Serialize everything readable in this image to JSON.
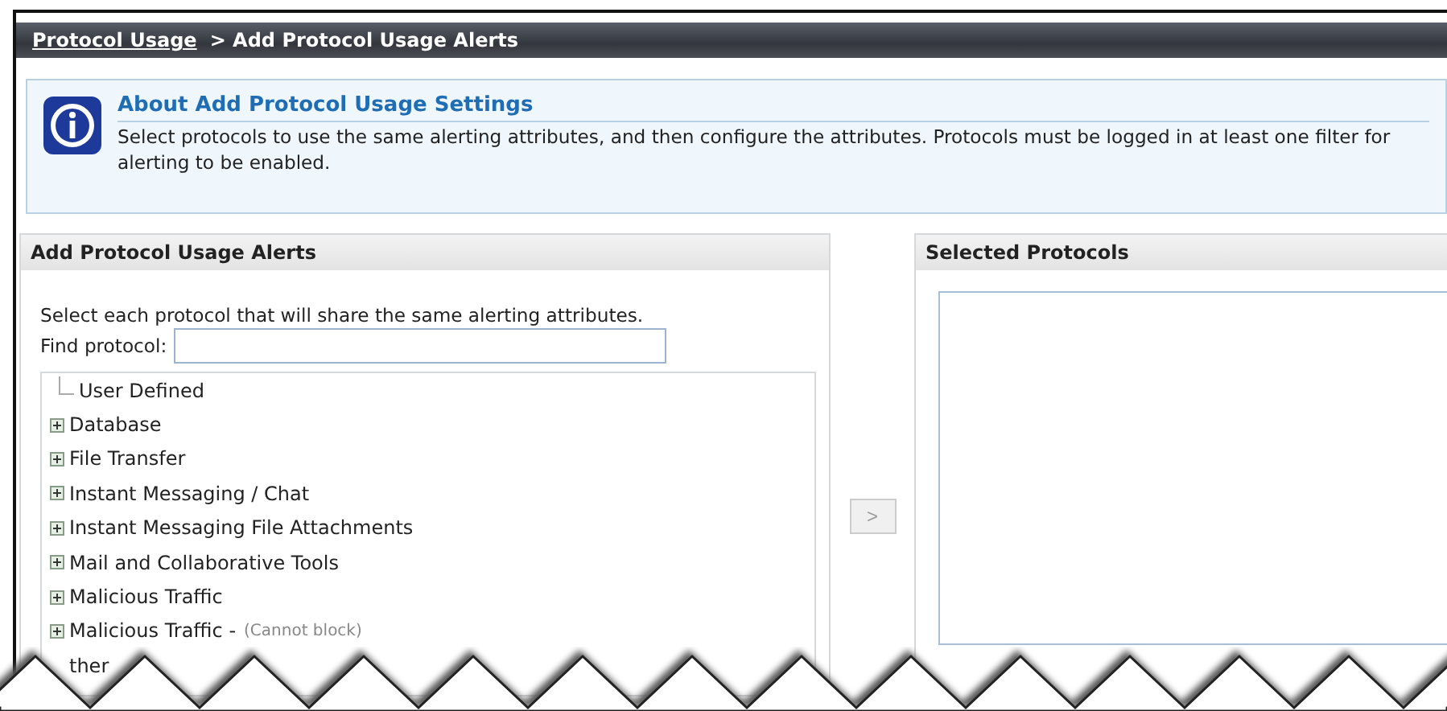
{
  "breadcrumb": {
    "link": "Protocol Usage",
    "current": "> Add Protocol Usage Alerts"
  },
  "info": {
    "title": "About Add Protocol Usage Settings",
    "text": "Select protocols to use the same alerting attributes, and then configure the attributes. Protocols must be logged in at least one filter for alerting to be enabled."
  },
  "left_panel": {
    "title": "Add Protocol Usage Alerts",
    "instructions": "Select each protocol that will share the same alerting attributes.",
    "find_label": "Find protocol:",
    "tree": [
      {
        "label": "User Defined",
        "kind": "leaf"
      },
      {
        "label": "Database",
        "kind": "group"
      },
      {
        "label": "File Transfer",
        "kind": "group"
      },
      {
        "label": "Instant Messaging / Chat",
        "kind": "group"
      },
      {
        "label": "Instant Messaging File Attachments",
        "kind": "group"
      },
      {
        "label": "Mail and Collaborative Tools",
        "kind": "group"
      },
      {
        "label": "Malicious Traffic",
        "kind": "group"
      },
      {
        "label": "Malicious Traffic -",
        "note": "(Cannot block)",
        "kind": "group"
      },
      {
        "label": "ther",
        "kind": "cut"
      }
    ]
  },
  "add_button": ">",
  "right_panel": {
    "title": "Selected Protocols"
  }
}
